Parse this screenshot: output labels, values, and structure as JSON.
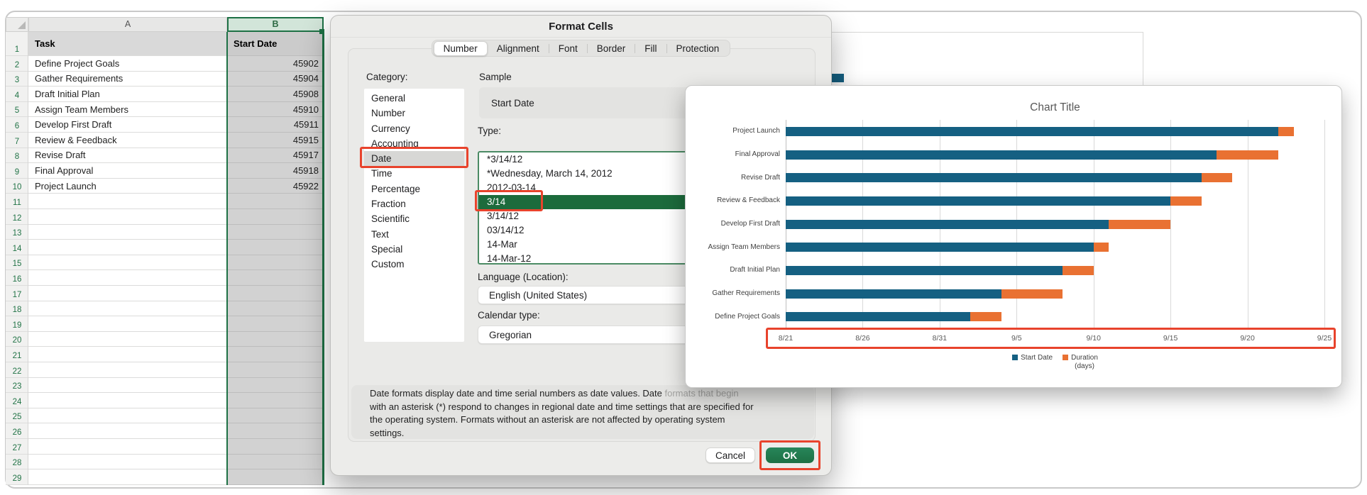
{
  "ui_colors": {
    "excel_green": "#217346",
    "selection_green": "#1e7145",
    "annotation_red": "#E8432C",
    "bar_teal": "#156082",
    "bar_orange": "#E97132"
  },
  "spreadsheet": {
    "col_headers": [
      "A",
      "B"
    ],
    "header_row": {
      "task": "Task",
      "start_date": "Start Date"
    },
    "rows": [
      {
        "n": 2,
        "task": "Define Project Goals",
        "start": "45902"
      },
      {
        "n": 3,
        "task": "Gather Requirements",
        "start": "45904"
      },
      {
        "n": 4,
        "task": "Draft Initial Plan",
        "start": "45908"
      },
      {
        "n": 5,
        "task": "Assign Team Members",
        "start": "45910"
      },
      {
        "n": 6,
        "task": "Develop First Draft",
        "start": "45911"
      },
      {
        "n": 7,
        "task": "Review & Feedback",
        "start": "45915"
      },
      {
        "n": 8,
        "task": "Revise Draft",
        "start": "45917"
      },
      {
        "n": 9,
        "task": "Final Approval",
        "start": "45918"
      },
      {
        "n": 10,
        "task": "Project Launch",
        "start": "45922"
      }
    ],
    "visible_row_count": 29,
    "selected_column": "B"
  },
  "dialog": {
    "title": "Format Cells",
    "tabs": [
      {
        "label": "Number",
        "selected": true
      },
      {
        "label": "Alignment",
        "selected": false
      },
      {
        "label": "Font",
        "selected": false
      },
      {
        "label": "Border",
        "selected": false
      },
      {
        "label": "Fill",
        "selected": false
      },
      {
        "label": "Protection",
        "selected": false
      }
    ],
    "category_label": "Category:",
    "categories": [
      "General",
      "Number",
      "Currency",
      "Accounting",
      "Date",
      "Time",
      "Percentage",
      "Fraction",
      "Scientific",
      "Text",
      "Special",
      "Custom"
    ],
    "selected_category": "Date",
    "sample_label": "Sample",
    "sample_value": "Start Date",
    "type_label": "Type:",
    "types": [
      "*3/14/12",
      "*Wednesday, March 14, 2012",
      "2012-03-14",
      "3/14",
      "3/14/12",
      "03/14/12",
      "14-Mar",
      "14-Mar-12"
    ],
    "selected_type": "3/14",
    "language_label": "Language (Location):",
    "language_value": "English (United States)",
    "calendar_label": "Calendar type:",
    "calendar_value": "Gregorian",
    "description": {
      "line1_normal": "Date formats display date and time serial numbers as date values.  Date ",
      "line1_dimmed": "formats that begin",
      "line2": "with an asterisk (*) respond to changes in regional date and time settings that are specified for",
      "line3": "the operating system. Formats without an asterisk are not affected by operating system",
      "line4": "settings."
    },
    "cancel_label": "Cancel",
    "ok_label": "OK"
  },
  "chart_data": {
    "type": "bar",
    "orientation": "horizontal",
    "stacked": true,
    "title": "Chart Title",
    "categories_top_to_bottom": [
      "Project Launch",
      "Final Approval",
      "Revise Draft",
      "Review & Feedback",
      "Develop First Draft",
      "Assign Team Members",
      "Draft Initial Plan",
      "Gather Requirements",
      "Define Project Goals"
    ],
    "series": [
      {
        "name": "Start Date",
        "color": "#156082",
        "days_from_axis_min": [
          32,
          28,
          27,
          25,
          21,
          20,
          18,
          14,
          12
        ],
        "dates": [
          "9/22",
          "9/18",
          "9/17",
          "9/15",
          "9/11",
          "9/10",
          "9/8",
          "9/4",
          "9/2"
        ]
      },
      {
        "name": "Duration (days)",
        "color": "#E97132",
        "values": [
          1,
          4,
          2,
          2,
          4,
          1,
          2,
          4,
          2
        ]
      }
    ],
    "x_axis": {
      "ticks": [
        "8/21",
        "8/26",
        "8/31",
        "9/5",
        "9/10",
        "9/15",
        "9/20",
        "9/25"
      ],
      "min_days": 0,
      "max_days": 35,
      "tick_interval_days": 5
    },
    "legend": {
      "items": [
        "Start Date",
        "Duration"
      ],
      "sub_label": "(days)",
      "position": "bottom"
    },
    "grid": "vertical"
  }
}
